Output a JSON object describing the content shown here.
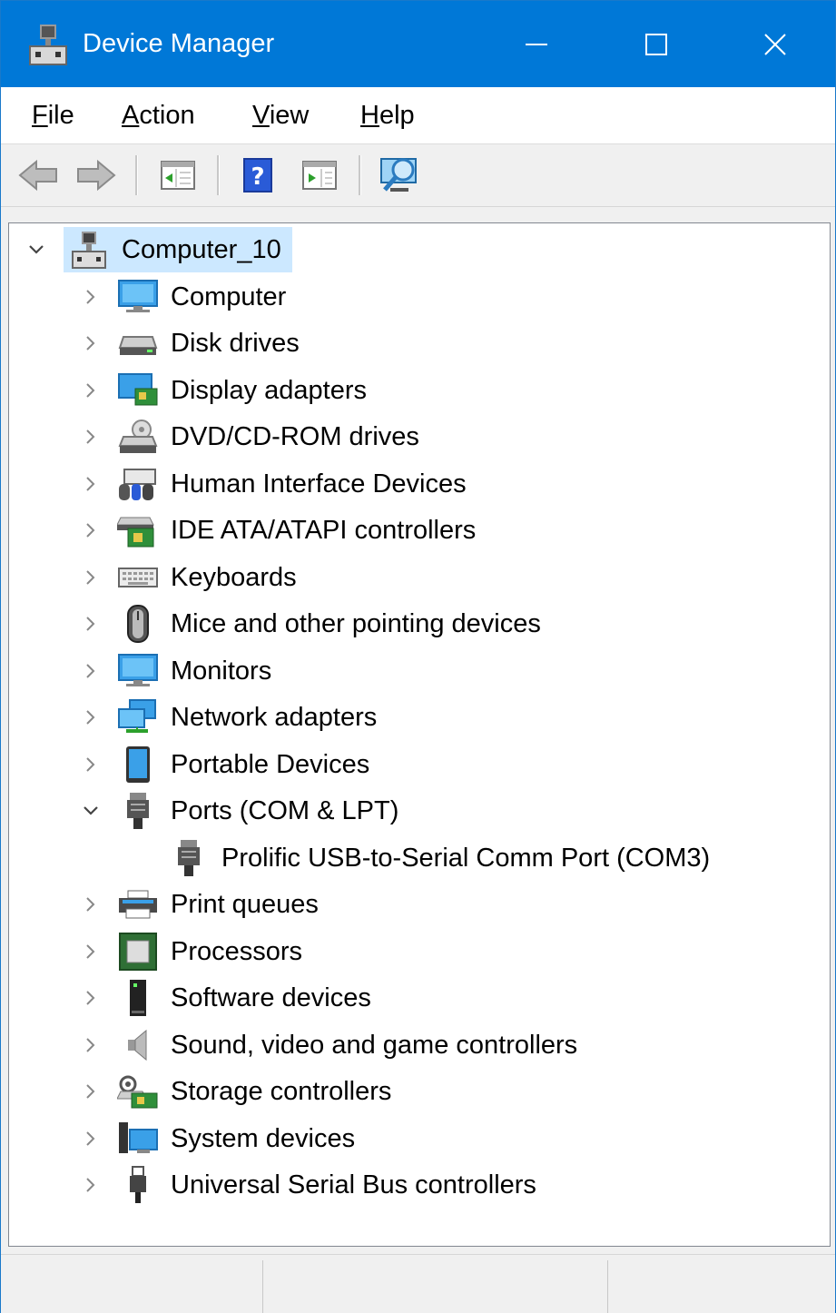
{
  "window": {
    "title": "Device Manager",
    "accent_color": "#0078d7"
  },
  "menu": {
    "items": [
      {
        "label": "File",
        "mnemonic": "F",
        "rest": "ile"
      },
      {
        "label": "Action",
        "mnemonic": "A",
        "rest": "ction"
      },
      {
        "label": "View",
        "mnemonic": "V",
        "rest": "iew"
      },
      {
        "label": "Help",
        "mnemonic": "H",
        "rest": "elp"
      }
    ]
  },
  "toolbar": {
    "buttons": [
      "back-icon",
      "forward-icon",
      "properties-icon",
      "help-icon",
      "update-driver-icon",
      "scan-hardware-icon"
    ]
  },
  "tree": {
    "root": {
      "label": "Computer_10",
      "expanded": true,
      "selected": true,
      "icon": "computer-tower-icon"
    },
    "categories": [
      {
        "label": "Computer",
        "icon": "computer-icon",
        "expanded": false
      },
      {
        "label": "Disk drives",
        "icon": "disk-drive-icon",
        "expanded": false
      },
      {
        "label": "Display adapters",
        "icon": "display-adapter-icon",
        "expanded": false
      },
      {
        "label": "DVD/CD-ROM drives",
        "icon": "dvd-drive-icon",
        "expanded": false
      },
      {
        "label": "Human Interface Devices",
        "icon": "hid-icon",
        "expanded": false
      },
      {
        "label": "IDE ATA/ATAPI controllers",
        "icon": "ide-controller-icon",
        "expanded": false
      },
      {
        "label": "Keyboards",
        "icon": "keyboard-icon",
        "expanded": false
      },
      {
        "label": "Mice and other pointing devices",
        "icon": "mouse-icon",
        "expanded": false
      },
      {
        "label": "Monitors",
        "icon": "monitor-icon",
        "expanded": false
      },
      {
        "label": "Network adapters",
        "icon": "network-adapter-icon",
        "expanded": false
      },
      {
        "label": "Portable Devices",
        "icon": "portable-device-icon",
        "expanded": false
      },
      {
        "label": "Ports (COM & LPT)",
        "icon": "port-icon",
        "expanded": true,
        "children": [
          {
            "label": "Prolific USB-to-Serial Comm Port (COM3)",
            "icon": "serial-port-icon"
          }
        ]
      },
      {
        "label": "Print queues",
        "icon": "printer-icon",
        "expanded": false
      },
      {
        "label": "Processors",
        "icon": "processor-icon",
        "expanded": false
      },
      {
        "label": "Software devices",
        "icon": "software-device-icon",
        "expanded": false
      },
      {
        "label": "Sound, video and game controllers",
        "icon": "speaker-icon",
        "expanded": false
      },
      {
        "label": "Storage controllers",
        "icon": "storage-controller-icon",
        "expanded": false
      },
      {
        "label": "System devices",
        "icon": "system-device-icon",
        "expanded": false
      },
      {
        "label": "Universal Serial Bus controllers",
        "icon": "usb-icon",
        "expanded": false
      }
    ]
  },
  "colors": {
    "selection": "#cce8ff",
    "title_bar": "#0078d7"
  }
}
